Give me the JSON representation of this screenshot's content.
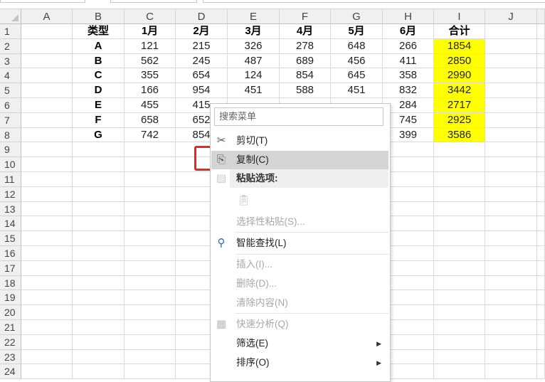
{
  "columns": [
    "A",
    "B",
    "C",
    "D",
    "E",
    "F",
    "G",
    "H",
    "I",
    "J"
  ],
  "rows": [
    "1",
    "2",
    "3",
    "4",
    "5",
    "6",
    "7",
    "8",
    "9",
    "10",
    "11",
    "12",
    "13",
    "14",
    "15",
    "16",
    "17",
    "18",
    "19",
    "20",
    "21",
    "22",
    "23",
    "24"
  ],
  "header_row": [
    "",
    "类型",
    "1月",
    "2月",
    "3月",
    "4月",
    "5月",
    "6月",
    "合计",
    ""
  ],
  "data_rows": [
    [
      "",
      "A",
      "121",
      "215",
      "326",
      "278",
      "648",
      "266",
      "1854",
      ""
    ],
    [
      "",
      "B",
      "562",
      "245",
      "487",
      "689",
      "456",
      "411",
      "2850",
      ""
    ],
    [
      "",
      "C",
      "355",
      "654",
      "124",
      "854",
      "645",
      "358",
      "2990",
      ""
    ],
    [
      "",
      "D",
      "166",
      "954",
      "451",
      "588",
      "451",
      "832",
      "3442",
      ""
    ],
    [
      "",
      "E",
      "455",
      "415",
      "",
      "",
      "",
      "284",
      "2717",
      ""
    ],
    [
      "",
      "F",
      "658",
      "652",
      "",
      "",
      "",
      "745",
      "2925",
      ""
    ],
    [
      "",
      "G",
      "742",
      "854",
      "",
      "",
      "",
      "399",
      "3586",
      ""
    ]
  ],
  "highlight_color": "#ffff00",
  "context_menu": {
    "search_placeholder": "搜索菜单",
    "items": [
      {
        "label": "剪切(T)",
        "icon": "scissors-icon",
        "disabled": false
      },
      {
        "label": "复制(C)",
        "icon": "copy-icon",
        "disabled": false,
        "highlighted": true
      },
      {
        "label": "粘贴选项:",
        "icon": "paste-icon",
        "disabled": false
      },
      {
        "label": "选择性粘贴(S)...",
        "disabled": true
      },
      {
        "label": "智能查找(L)",
        "icon": "smart-lookup-icon",
        "disabled": false
      },
      {
        "label": "插入(I)...",
        "disabled": true
      },
      {
        "label": "删除(D)...",
        "disabled": true
      },
      {
        "label": "清除内容(N)",
        "disabled": true
      },
      {
        "label": "快速分析(Q)",
        "icon": "quick-analysis-icon",
        "disabled": true
      },
      {
        "label": "筛选(E)",
        "submenu": true,
        "disabled": false
      },
      {
        "label": "排序(O)",
        "submenu": true,
        "disabled": false
      }
    ]
  },
  "annotation_color": "#e8261f"
}
